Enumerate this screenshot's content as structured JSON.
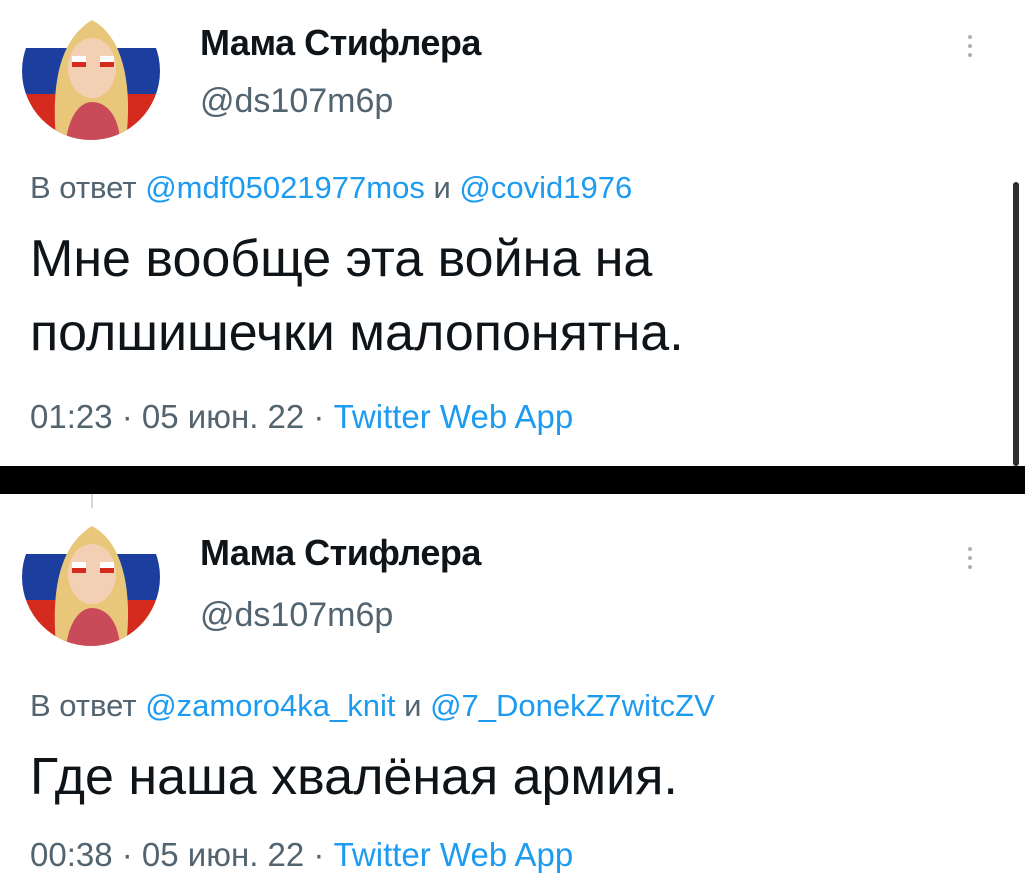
{
  "tweets": [
    {
      "author": {
        "display_name": "Мама Стифлера",
        "handle": "@ds107m6p"
      },
      "reply": {
        "prefix": "В ответ ",
        "mention_1": "@mdf05021977mos",
        "conjunction": " и ",
        "mention_2": "@covid1976"
      },
      "text_lines": [
        "Мне вообще эта война на",
        "полшишечки малопонятна."
      ],
      "time": "01:23",
      "separator": " · ",
      "date": "05 июн. 22",
      "source": "Twitter Web App"
    },
    {
      "author": {
        "display_name": "Мама Стифлера",
        "handle": "@ds107m6p"
      },
      "reply": {
        "prefix": "В ответ ",
        "mention_1": "@zamoro4ka_knit",
        "conjunction": " и ",
        "mention_2": "@7_DonekZ7witcZV"
      },
      "text_lines": [
        "Где наша хвалёная армия."
      ],
      "time": "00:38",
      "separator": " · ",
      "date": "05 июн. 22",
      "source": "Twitter Web App"
    }
  ],
  "icons": {
    "more": "more-vertical-icon",
    "avatar": "profile-avatar"
  },
  "colors": {
    "text_primary": "#0f1419",
    "text_secondary": "#536471",
    "link": "#1d9bf0",
    "flag_white": "#ffffff",
    "flag_blue": "#1c3f9f",
    "flag_red": "#d52b1e"
  }
}
